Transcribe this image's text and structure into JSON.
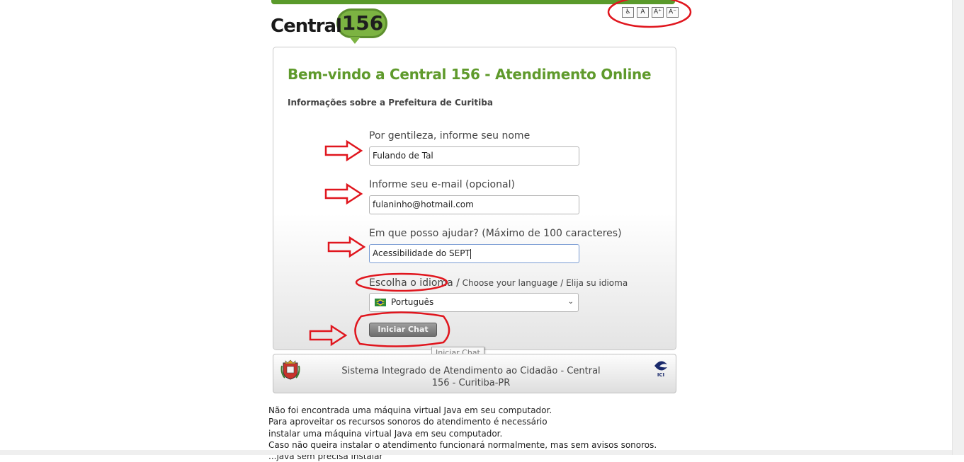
{
  "logo": {
    "text": "Central",
    "number": "156"
  },
  "accessibility": {
    "buttons": [
      {
        "label": "♿",
        "icon": "wheelchair-icon"
      },
      {
        "label": "A",
        "icon": "font-default-icon"
      },
      {
        "label": "A⁺",
        "icon": "font-increase-icon"
      },
      {
        "label": "A⁻",
        "icon": "font-decrease-icon"
      }
    ]
  },
  "card": {
    "title": "Bem-vindo a Central 156 - Atendimento Online",
    "subtitle": "Informações sobre a Prefeitura de Curitiba"
  },
  "form": {
    "name_label": "Por gentileza, informe seu nome",
    "name_value": "Fulando de Tal",
    "email_label": "Informe seu e-mail (opcional)",
    "email_value": "fulaninho@hotmail.com",
    "question_label": "Em que posso ajudar? (Máximo de 100 caracteres)",
    "question_value": "Acessibilidade do SEPT",
    "language_label_main": "Escolha o idioma /",
    "language_label_rest": " Choose your language / Elija su idioma",
    "language_selected": "Português",
    "submit_label": "Iniciar Chat",
    "submit_tooltip": "Iniciar Chat"
  },
  "footer": {
    "text": "Sistema Integrado de Atendimento ao Cidadão - Central 156 - Curitiba-PR",
    "right_logo_text": "ICI"
  },
  "notice": {
    "lines": [
      "Não foi encontrada uma máquina virtual Java em seu computador.",
      "Para aproveitar os recursos sonoros do atendimento é necessário",
      "instalar uma máquina virtual Java em seu computador.",
      "Caso não queira instalar o atendimento funcionará normalmente, mas sem avisos sonoros.",
      "...java sem precisa instalar"
    ]
  },
  "colors": {
    "brand_green": "#5f9a2c",
    "annotation_red": "#e0161e"
  }
}
